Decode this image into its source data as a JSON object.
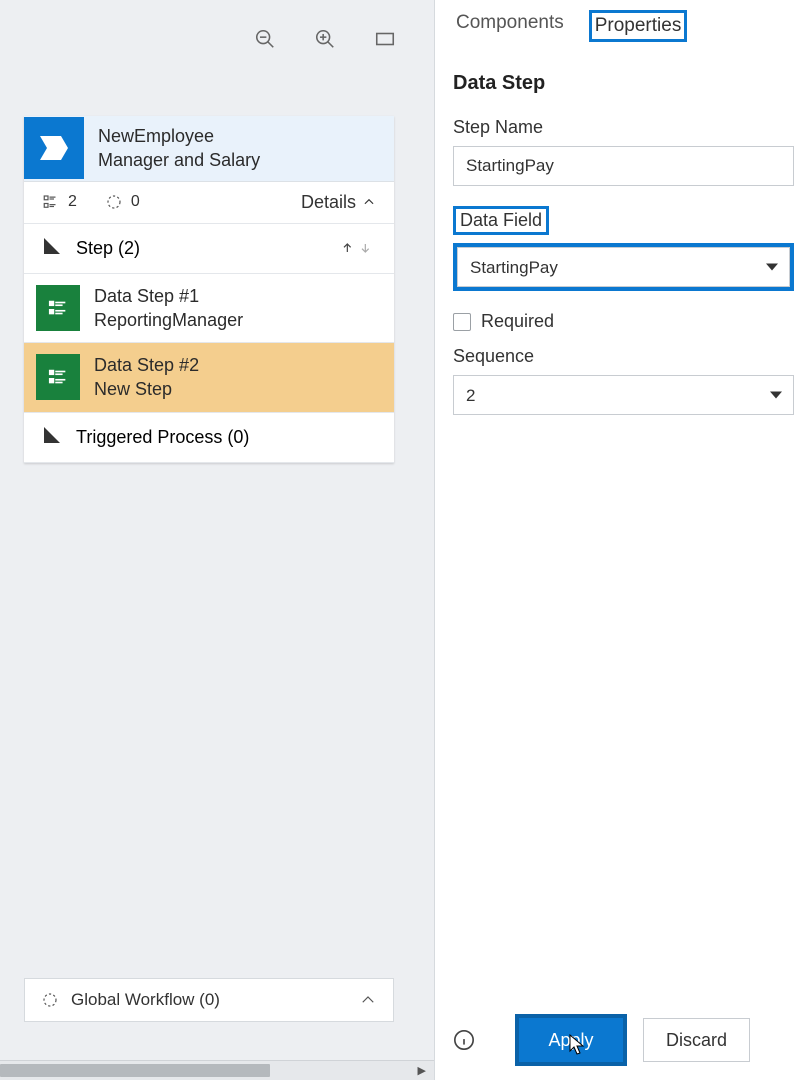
{
  "leftPane": {
    "card": {
      "titleLine1": "NewEmployee",
      "titleLine2": "Manager and Salary",
      "metricSteps": "2",
      "metricCircle": "0",
      "detailsLabel": "Details",
      "stepSectionLabel": "Step (2)",
      "steps": [
        {
          "line1": "Data Step #1",
          "line2": "ReportingManager"
        },
        {
          "line1": "Data Step #2",
          "line2": "New Step"
        }
      ],
      "triggeredLabel": "Triggered Process (0)"
    },
    "globalWorkflowLabel": "Global Workflow (0)"
  },
  "rightPane": {
    "tabs": {
      "components": "Components",
      "properties": "Properties"
    },
    "heading": "Data Step",
    "stepNameLabel": "Step Name",
    "stepNameValue": "StartingPay",
    "dataFieldLabel": "Data Field",
    "dataFieldValue": "StartingPay",
    "requiredLabel": "Required",
    "sequenceLabel": "Sequence",
    "sequenceValue": "2",
    "applyLabel": "Apply",
    "discardLabel": "Discard"
  }
}
